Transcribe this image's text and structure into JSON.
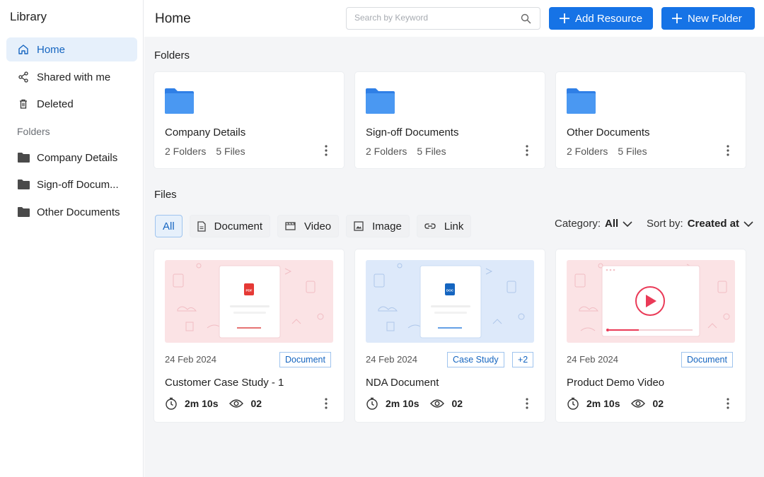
{
  "sidebar": {
    "title": "Library",
    "nav": [
      {
        "label": "Home",
        "icon": "home-icon"
      },
      {
        "label": "Shared with me",
        "icon": "share-icon"
      },
      {
        "label": "Deleted",
        "icon": "trash-icon"
      }
    ],
    "folders_label": "Folders",
    "folders": [
      {
        "label": "Company Details",
        "icon": "folder-icon"
      },
      {
        "label": "Sign-off Docum...",
        "icon": "folder-icon"
      },
      {
        "label": "Other Documents",
        "icon": "folder-icon"
      }
    ]
  },
  "header": {
    "title": "Home",
    "search_placeholder": "Search by Keyword",
    "add_resource": "Add Resource",
    "new_folder": "New Folder"
  },
  "folders_section": {
    "title": "Folders",
    "cards": [
      {
        "name": "Company Details",
        "folders": "2 Folders",
        "files": "5 Files"
      },
      {
        "name": "Sign-off Documents",
        "folders": "2 Folders",
        "files": "5 Files"
      },
      {
        "name": "Other Documents",
        "folders": "2 Folders",
        "files": "5 Files"
      }
    ]
  },
  "files_section": {
    "title": "Files",
    "tabs": [
      "All",
      "Document",
      "Video",
      "Image",
      "Link"
    ],
    "category_label": "Category:",
    "category_value": "All",
    "sort_label": "Sort by:",
    "sort_value": "Created at",
    "cards": [
      {
        "date": "24 Feb 2024",
        "tag": "Document",
        "extra": "",
        "name": "Customer Case Study - 1",
        "duration": "2m 10s",
        "views": "02",
        "file_badge": "PDF"
      },
      {
        "date": "24 Feb 2024",
        "tag": "Case Study",
        "extra": "+2",
        "name": "NDA Document",
        "duration": "2m 10s",
        "views": "02",
        "file_badge": "DOC"
      },
      {
        "date": "24 Feb 2024",
        "tag": "Document",
        "extra": "",
        "name": "Product Demo Video",
        "duration": "2m 10s",
        "views": "02",
        "file_badge": ""
      }
    ]
  },
  "colors": {
    "accent": "#1673e6",
    "folder": "#3d8ef0",
    "pink_bg": "#fbe3e5",
    "blue_bg": "#dde9fa"
  }
}
